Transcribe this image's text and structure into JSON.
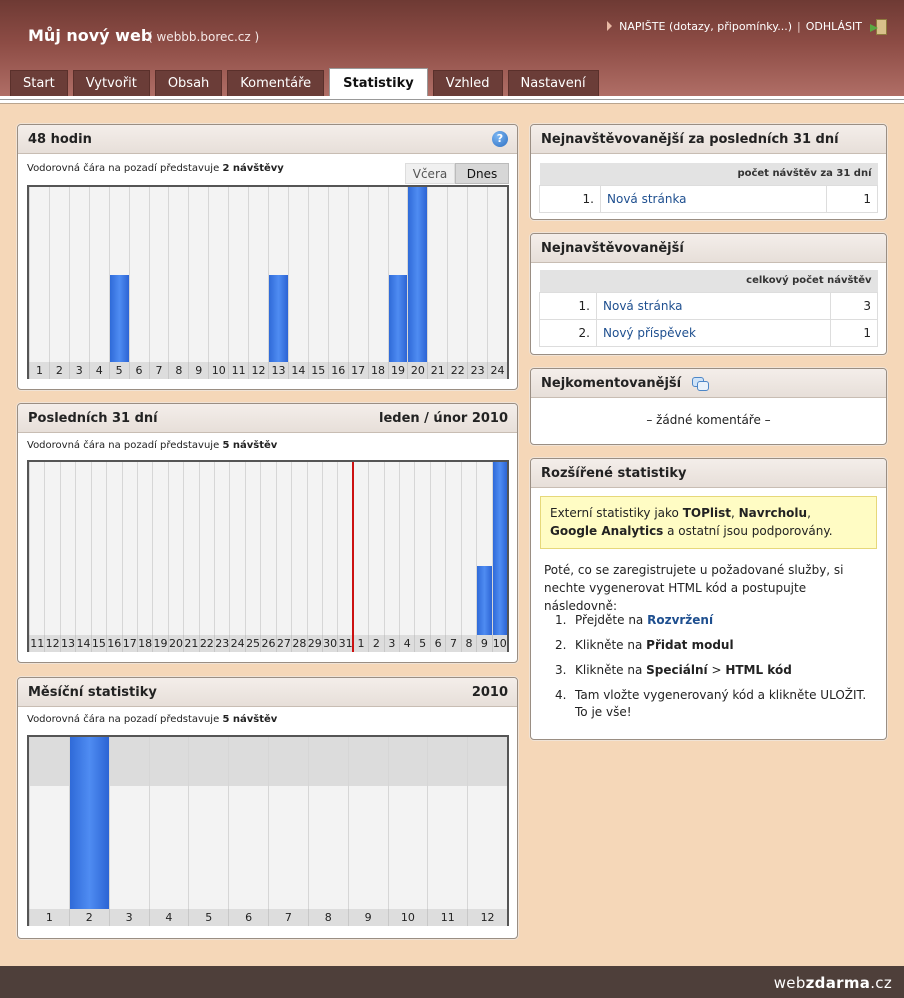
{
  "header": {
    "site_title": "Můj nový web",
    "site_domain": "( webbb.borec.cz )",
    "write_link": "NAPIŠTE (dotazy, připomínky...)",
    "separator": "|",
    "logout_link": "ODHLÁSIT"
  },
  "tabs": [
    {
      "label": "Start",
      "active": false
    },
    {
      "label": "Vytvořit",
      "active": false
    },
    {
      "label": "Obsah",
      "active": false
    },
    {
      "label": "Komentáře",
      "active": false
    },
    {
      "label": "Statistiky",
      "active": true
    },
    {
      "label": "Vzhled",
      "active": false
    },
    {
      "label": "Nastavení",
      "active": false
    }
  ],
  "hours_panel": {
    "title": "48 hodin",
    "note_prefix": "Vodorovná čára na pozadí představuje",
    "note_value": "2 návštěvy",
    "btn_yesterday": "Včera",
    "btn_today": "Dnes",
    "help_icon": "?"
  },
  "days_panel": {
    "title": "Posledních 31 dní",
    "period": "leden / únor 2010",
    "note_prefix": "Vodorovná čára na pozadí představuje",
    "note_value": "5 návštěv"
  },
  "months_panel": {
    "title": "Měsíční statistiky",
    "year": "2010",
    "note_prefix": "Vodorovná čára na pozadí představuje",
    "note_value": "5 návštěv"
  },
  "chart_data": [
    {
      "type": "bar",
      "title": "48 hodin",
      "categories": [
        "1",
        "2",
        "3",
        "4",
        "5",
        "6",
        "7",
        "8",
        "9",
        "10",
        "11",
        "12",
        "13",
        "14",
        "15",
        "16",
        "17",
        "18",
        "19",
        "20",
        "21",
        "22",
        "23",
        "24"
      ],
      "values": [
        0,
        0,
        0,
        0,
        1,
        0,
        0,
        0,
        0,
        0,
        0,
        0,
        1,
        0,
        0,
        0,
        0,
        0,
        1,
        2,
        0,
        0,
        0,
        0
      ],
      "ylim": [
        0,
        2
      ]
    },
    {
      "type": "bar",
      "title": "Posledních 31 dní",
      "categories": [
        "11",
        "12",
        "13",
        "14",
        "15",
        "16",
        "17",
        "18",
        "19",
        "20",
        "21",
        "22",
        "23",
        "24",
        "25",
        "26",
        "27",
        "28",
        "29",
        "30",
        "31",
        "1",
        "2",
        "3",
        "4",
        "5",
        "6",
        "7",
        "8",
        "9",
        "10"
      ],
      "values": [
        0,
        0,
        0,
        0,
        0,
        0,
        0,
        0,
        0,
        0,
        0,
        0,
        0,
        0,
        0,
        0,
        0,
        0,
        0,
        0,
        0,
        0,
        0,
        0,
        0,
        0,
        0,
        0,
        0,
        2,
        5
      ],
      "ylim": [
        0,
        5
      ],
      "divider_after_category_index": 20
    },
    {
      "type": "bar",
      "title": "Měsíční statistiky",
      "categories": [
        "1",
        "2",
        "3",
        "4",
        "5",
        "6",
        "7",
        "8",
        "9",
        "10",
        "11",
        "12"
      ],
      "values": [
        0,
        7,
        0,
        0,
        0,
        0,
        0,
        0,
        0,
        0,
        0,
        0
      ],
      "ylim": [
        0,
        7
      ],
      "reference_line": 5
    }
  ],
  "top31": {
    "title": "Nejnavštěvovanější za posledních 31 dní",
    "col_header": "počet návštěv za 31 dní",
    "rows": [
      {
        "rank": "1.",
        "name": "Nová stránka",
        "count": "1"
      }
    ]
  },
  "top_all": {
    "title": "Nejnavštěvovanější",
    "col_header": "celkový počet návštěv",
    "rows": [
      {
        "rank": "1.",
        "name": "Nová stránka",
        "count": "3"
      },
      {
        "rank": "2.",
        "name": "Nový příspěvek",
        "count": "1"
      }
    ]
  },
  "most_commented": {
    "title": "Nejkomentovanější",
    "empty": "– žádné komentáře –"
  },
  "extended": {
    "title": "Rozšířené statistiky",
    "box_t1": "Externí statistiky jako ",
    "box_b1": "TOPlist",
    "box_t2": ", ",
    "box_b2": "Navrcholu",
    "box_t3": ",",
    "box_b3": "Google Analytics",
    "box_t4": " a ostatní jsou podporovány.",
    "para": "Poté, co se zaregistrujete u požadované služby, si nechte vygenerovat HTML kód a postupujte následovně:",
    "steps": [
      {
        "num": "1.",
        "pre": "Přejděte na ",
        "bold": "Rozvržení",
        "mid": "",
        "bold2": "",
        "post": ""
      },
      {
        "num": "2.",
        "pre": "Klikněte na ",
        "bold": "Přidat modul",
        "mid": "",
        "bold2": "",
        "post": ""
      },
      {
        "num": "3.",
        "pre": "Klikněte na ",
        "bold": "Speciální",
        "mid": " > ",
        "bold2": "HTML kód",
        "post": ""
      },
      {
        "num": "4.",
        "pre": "Tam vložte vygenerovaný kód a klikněte ULOŽIT. To je vše!",
        "bold": "",
        "mid": "",
        "bold2": "",
        "post": ""
      }
    ]
  },
  "footer": {
    "logo_a": "web",
    "logo_b": "zdarma",
    "logo_c": ".cz"
  },
  "colors": {
    "header": "#8d4c45",
    "background": "#f5d7b8",
    "bar": "#3b76e0",
    "divider": "#cc1111"
  }
}
